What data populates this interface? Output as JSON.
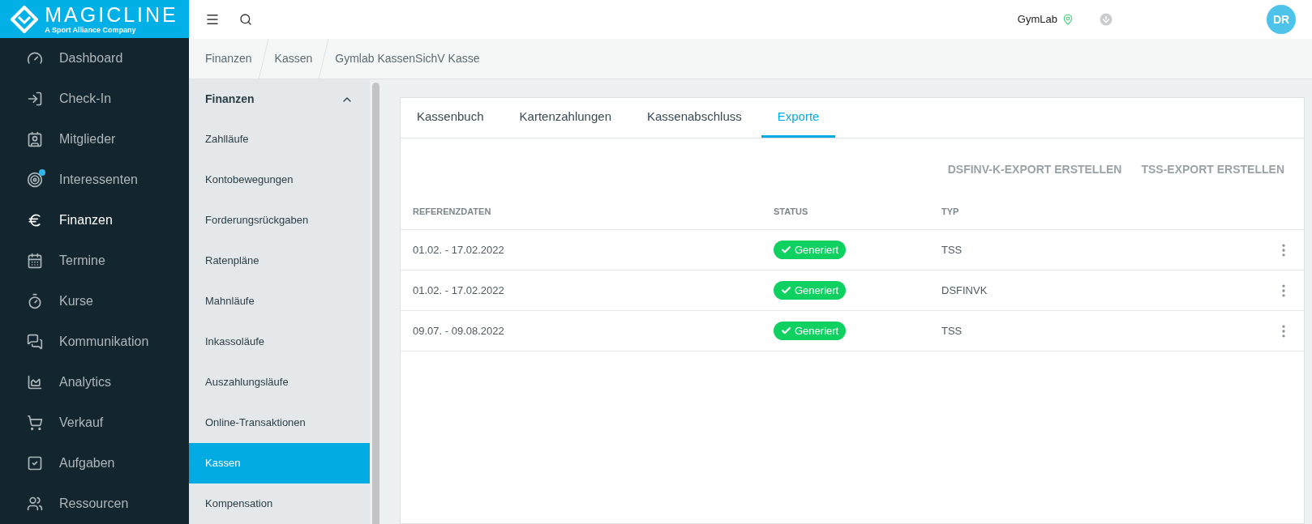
{
  "logo": {
    "name": "MAGICLINE",
    "tagline": "A Sport Alliance Company"
  },
  "topbar": {
    "studio": "GymLab",
    "avatar": "DR"
  },
  "nav": [
    {
      "label": "Dashboard",
      "selected": false,
      "notification": false
    },
    {
      "label": "Check-In",
      "selected": false,
      "notification": false
    },
    {
      "label": "Mitglieder",
      "selected": false,
      "notification": false
    },
    {
      "label": "Interessenten",
      "selected": false,
      "notification": true
    },
    {
      "label": "Finanzen",
      "selected": true,
      "notification": false
    },
    {
      "label": "Termine",
      "selected": false,
      "notification": false
    },
    {
      "label": "Kurse",
      "selected": false,
      "notification": false
    },
    {
      "label": "Kommunikation",
      "selected": false,
      "notification": false
    },
    {
      "label": "Analytics",
      "selected": false,
      "notification": false
    },
    {
      "label": "Verkauf",
      "selected": false,
      "notification": false
    },
    {
      "label": "Aufgaben",
      "selected": false,
      "notification": false
    },
    {
      "label": "Ressourcen",
      "selected": false,
      "notification": false
    }
  ],
  "breadcrumb": [
    "Finanzen",
    "Kassen",
    "Gymlab KassenSichV Kasse"
  ],
  "subnav": {
    "title": "Finanzen",
    "expanded": true,
    "items": [
      {
        "label": "Zahlläufe",
        "selected": false
      },
      {
        "label": "Kontobewegungen",
        "selected": false
      },
      {
        "label": "Forderungsrückgaben",
        "selected": false
      },
      {
        "label": "Ratenpläne",
        "selected": false
      },
      {
        "label": "Mahnläufe",
        "selected": false
      },
      {
        "label": "Inkassoläufe",
        "selected": false
      },
      {
        "label": "Auszahlungsläufe",
        "selected": false
      },
      {
        "label": "Online-Transaktionen",
        "selected": false
      },
      {
        "label": "Kassen",
        "selected": true
      },
      {
        "label": "Kompensation",
        "selected": false
      }
    ]
  },
  "tabs": [
    {
      "label": "Kassenbuch",
      "selected": false
    },
    {
      "label": "Kartenzahlungen",
      "selected": false
    },
    {
      "label": "Kassenabschluss",
      "selected": false
    },
    {
      "label": "Exporte",
      "selected": true
    }
  ],
  "actions": [
    "DSFINV-K-EXPORT ERSTELLEN",
    "TSS-EXPORT ERSTELLEN"
  ],
  "table": {
    "columns": [
      "REFERENZDATEN",
      "STATUS",
      "TYP"
    ],
    "rows": [
      {
        "date": "01.02. - 17.02.2022",
        "status": "Generiert",
        "kind": "success",
        "type": "TSS"
      },
      {
        "date": "01.02. - 17.02.2022",
        "status": "Generiert",
        "kind": "success",
        "type": "DSFINVK"
      },
      {
        "date": "09.07. - 09.08.2022",
        "status": "Generiert",
        "kind": "success",
        "type": "TSS"
      }
    ]
  }
}
